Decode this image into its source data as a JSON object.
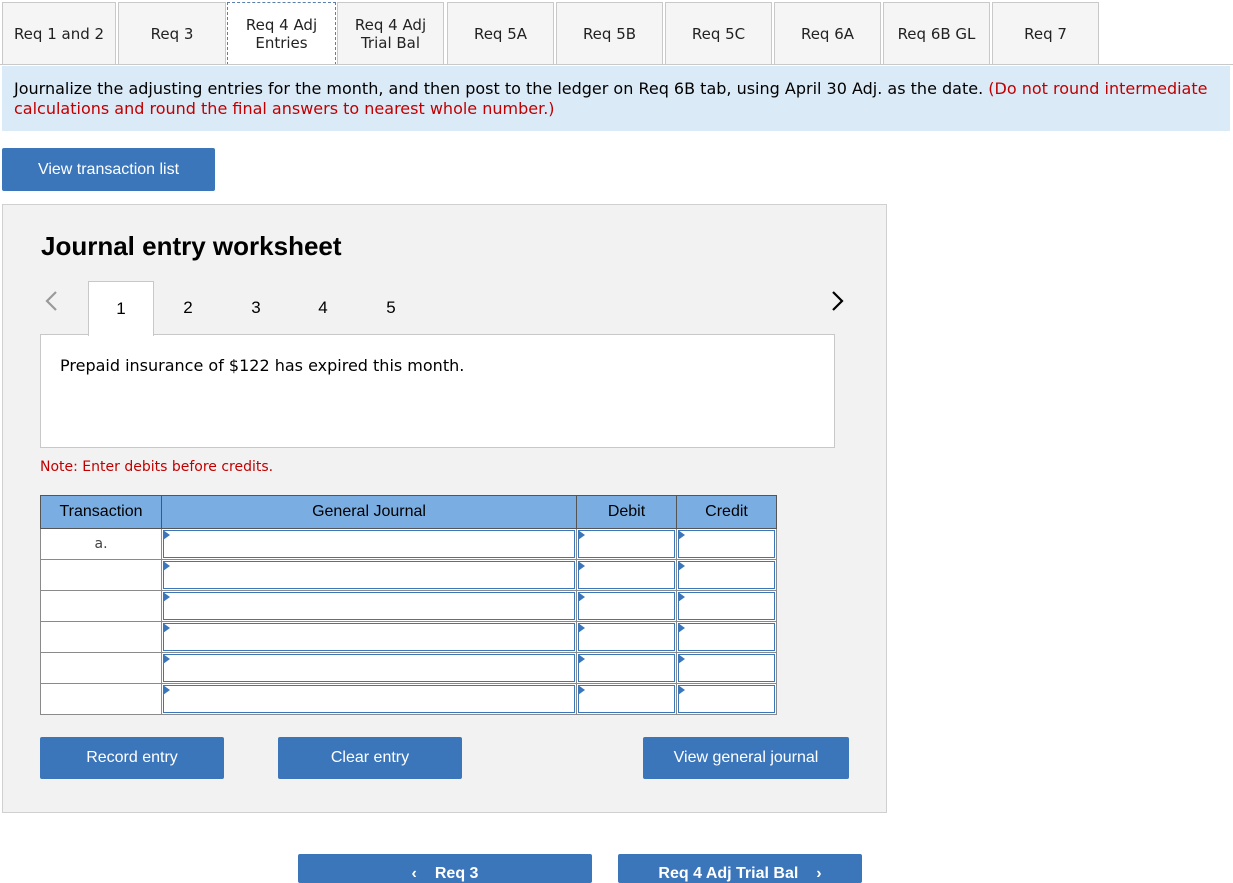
{
  "tabs": [
    {
      "label": "Req 1 and 2",
      "active": false
    },
    {
      "label": "Req 3",
      "active": false
    },
    {
      "label": "Req 4 Adj\nEntries",
      "active": true
    },
    {
      "label": "Req 4 Adj\nTrial Bal",
      "active": false
    },
    {
      "label": "Req 5A",
      "active": false
    },
    {
      "label": "Req 5B",
      "active": false
    },
    {
      "label": "Req 5C",
      "active": false
    },
    {
      "label": "Req 6A",
      "active": false
    },
    {
      "label": "Req 6B GL",
      "active": false
    },
    {
      "label": "Req 7",
      "active": false
    }
  ],
  "instructions": {
    "text": "Journalize the adjusting entries for the month, and then post to the ledger on Req 6B tab, using April 30 Adj. as the date. ",
    "red_text": "(Do not round intermediate calculations and round the final answers to nearest whole number.)"
  },
  "view_transaction_button": "View transaction list",
  "worksheet": {
    "title": "Journal entry worksheet",
    "pages": [
      "1",
      "2",
      "3",
      "4",
      "5"
    ],
    "active_page": "1",
    "prev_icon": "chevron-left-icon",
    "next_icon": "chevron-right-icon",
    "description": "Prepaid insurance of $122 has expired this month.",
    "note": "Note: Enter debits before credits.",
    "table": {
      "headers": [
        "Transaction",
        "General Journal",
        "Debit",
        "Credit"
      ],
      "rows": [
        {
          "transaction": "a."
        },
        {
          "transaction": ""
        },
        {
          "transaction": ""
        },
        {
          "transaction": ""
        },
        {
          "transaction": ""
        },
        {
          "transaction": ""
        }
      ]
    },
    "record_button": "Record entry",
    "clear_button": "Clear entry",
    "view_journal_button": "View general journal"
  },
  "nav": {
    "prev_label": "Req 3",
    "next_label": "Req 4 Adj Trial Bal"
  },
  "colors": {
    "button": "#3b76bb",
    "header": "#7aaee3",
    "instruction_bg": "#dbeaf7",
    "red": "#c00000"
  }
}
